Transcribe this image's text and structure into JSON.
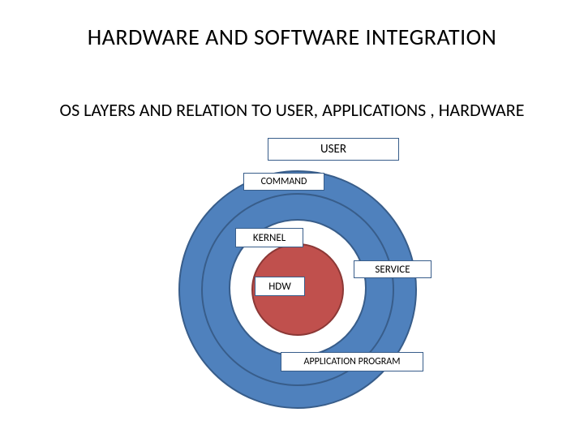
{
  "title": "HARDWARE AND SOFTWARE INTEGRATION",
  "subtitle": "OS LAYERS AND RELATION TO USER, APPLICATIONS , HARDWARE",
  "labels": {
    "user": "USER",
    "command": "COMMAND",
    "kernel": "KERNEL",
    "hdw": "HDW",
    "service": "SERVICE",
    "app": "APPLICATION PROGRAM"
  },
  "colors": {
    "ring_fill": "#4f81bd",
    "ring_stroke": "#385d8a",
    "core_fill": "#c0504d",
    "core_stroke": "#8c3836",
    "box_fill": "#ffffff",
    "box_stroke": "#385d8a"
  },
  "diagram": {
    "type": "concentric-layers",
    "layers_outer_to_inner": [
      "user",
      "command",
      "kernel",
      "service",
      "app",
      "hdw"
    ],
    "note": "Labels are placed as callout boxes on/around concentric rings; hardware is the innermost core."
  }
}
